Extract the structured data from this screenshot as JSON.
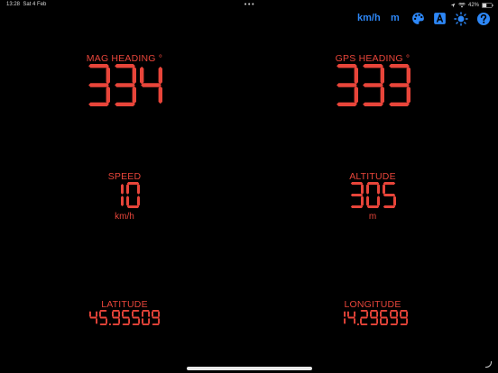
{
  "status_bar": {
    "time": "13:28",
    "date": "Sat 4 Feb",
    "battery": "42%"
  },
  "toolbar": {
    "speed_unit": "km/h",
    "altitude_unit": "m",
    "icons": [
      "palette-icon",
      "font-icon",
      "brightness-icon",
      "help-icon"
    ],
    "accent_color": "#2d87f7"
  },
  "display": {
    "color": "#e8453a",
    "mag_heading": {
      "label": "MAG HEADING °",
      "value": "334"
    },
    "gps_heading": {
      "label": "GPS HEADING °",
      "value": "333"
    },
    "speed": {
      "label": "SPEED",
      "value": "10",
      "unit": "km/h"
    },
    "altitude": {
      "label": "ALTITUDE",
      "value": "305",
      "unit": "m"
    },
    "latitude": {
      "label": "LATITUDE",
      "value": "45.95509"
    },
    "longitude": {
      "label": "LONGITUDE",
      "value": "14.29699"
    }
  }
}
